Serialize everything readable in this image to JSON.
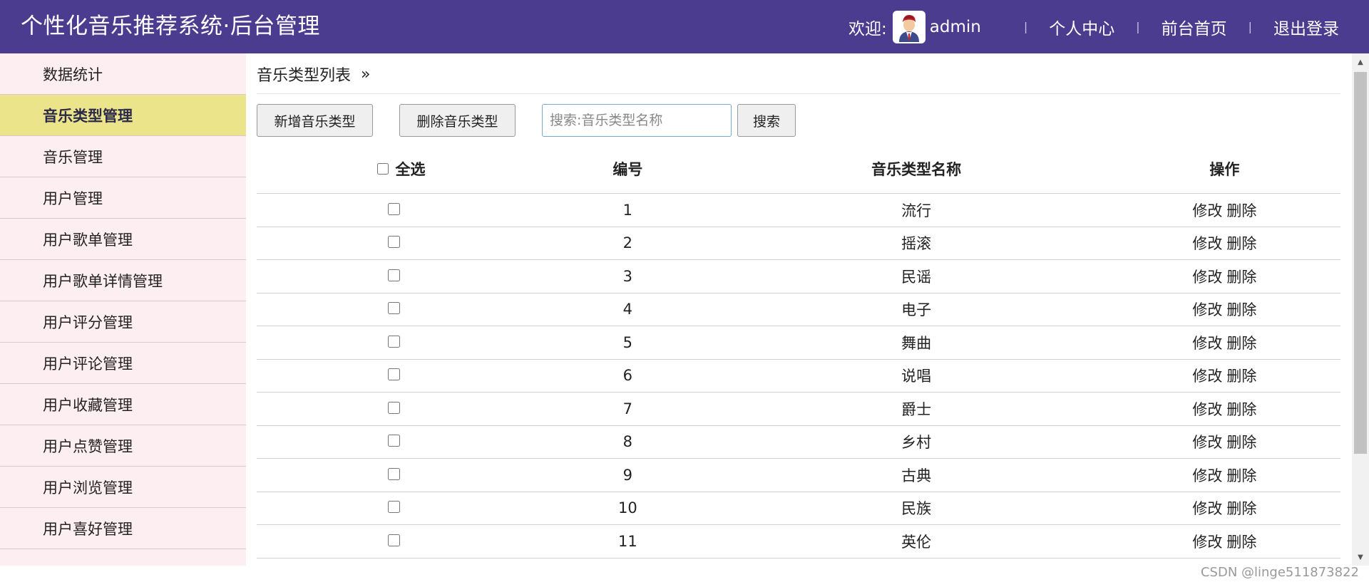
{
  "header": {
    "title": "个性化音乐推荐系统·后台管理",
    "welcome": "欢迎:",
    "username": "admin",
    "links": [
      "个人中心",
      "前台首页",
      "退出登录"
    ]
  },
  "sidebar": {
    "items": [
      {
        "label": "数据统计",
        "active": false
      },
      {
        "label": "音乐类型管理",
        "active": true
      },
      {
        "label": "音乐管理",
        "active": false
      },
      {
        "label": "用户管理",
        "active": false
      },
      {
        "label": "用户歌单管理",
        "active": false
      },
      {
        "label": "用户歌单详情管理",
        "active": false
      },
      {
        "label": "用户评分管理",
        "active": false
      },
      {
        "label": "用户评论管理",
        "active": false
      },
      {
        "label": "用户收藏管理",
        "active": false
      },
      {
        "label": "用户点赞管理",
        "active": false
      },
      {
        "label": "用户浏览管理",
        "active": false
      },
      {
        "label": "用户喜好管理",
        "active": false
      }
    ]
  },
  "main": {
    "breadcrumb": "音乐类型列表",
    "breadcrumb_arrow": "»",
    "toolbar": {
      "add_label": "新增音乐类型",
      "delete_label": "删除音乐类型",
      "search_placeholder": "搜索:音乐类型名称",
      "search_label": "搜索"
    },
    "table": {
      "headers": {
        "select_all": "全选",
        "id": "编号",
        "name": "音乐类型名称",
        "ops": "操作"
      },
      "edit_label": "修改",
      "delete_label": "删除",
      "rows": [
        {
          "id": "1",
          "name": "流行"
        },
        {
          "id": "2",
          "name": "摇滚"
        },
        {
          "id": "3",
          "name": "民谣"
        },
        {
          "id": "4",
          "name": "电子"
        },
        {
          "id": "5",
          "name": "舞曲"
        },
        {
          "id": "6",
          "name": "说唱"
        },
        {
          "id": "7",
          "name": "爵士"
        },
        {
          "id": "8",
          "name": "乡村"
        },
        {
          "id": "9",
          "name": "古典"
        },
        {
          "id": "10",
          "name": "民族"
        },
        {
          "id": "11",
          "name": "英伦"
        }
      ]
    }
  },
  "watermark": "CSDN @linge511873822",
  "colors": {
    "header_bg": "#4b3c8f",
    "sidebar_bg": "#fdeef1",
    "active_bg": "#ece48a"
  }
}
